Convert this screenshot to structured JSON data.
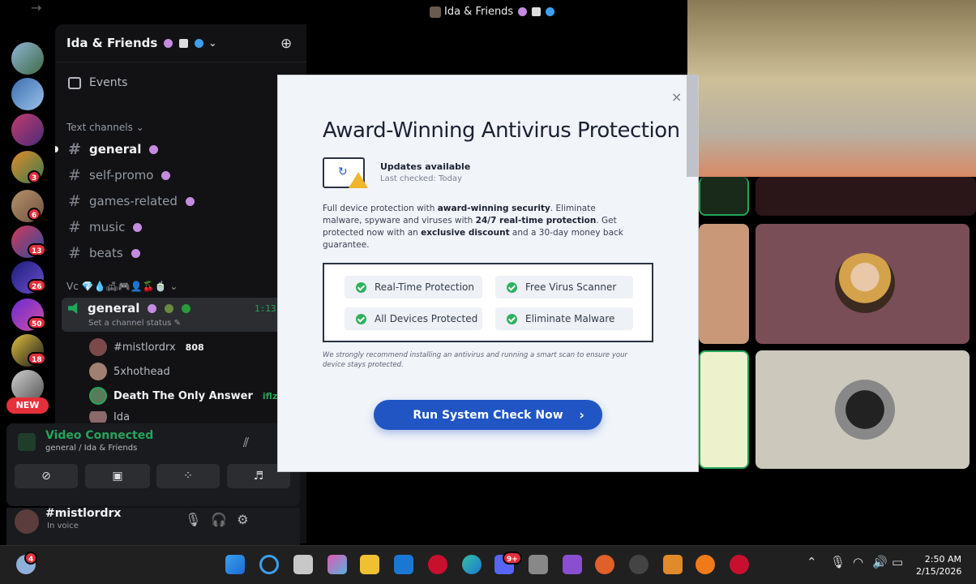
{
  "window": {
    "title": "Ida & Friends",
    "back": "←",
    "forward": "→"
  },
  "server": {
    "name": "Ida & Friends",
    "events_label": "Events",
    "text_category": "Text channels",
    "text_channels": [
      "general",
      "self-promo",
      "games-related",
      "music",
      "beats"
    ],
    "voice_category": "Vc",
    "voice_channel": {
      "name": "general",
      "time": "1:13",
      "status": "Set a channel status"
    },
    "voice_users": [
      {
        "name": "#mistlordrx",
        "tag": "808"
      },
      {
        "name": "5xhothead",
        "tag": ""
      },
      {
        "name": "Death The Only Answer",
        "tag": "iflze"
      },
      {
        "name": "Ida",
        "tag": ""
      }
    ],
    "rail_badges": [
      "3",
      "6",
      "13",
      "26",
      "50",
      "18"
    ],
    "new_label": "NEW"
  },
  "voice_panel": {
    "title": "Video Connected",
    "subtitle": "general / Ida & Friends"
  },
  "user_panel": {
    "name": "#mistlordrx",
    "status": "In voice"
  },
  "modal": {
    "title": "Award-Winning Antivirus Protection",
    "close": "×",
    "update_heading": "Updates available",
    "update_sub": "Last checked: Today",
    "para_1": "Full device protection with ",
    "para_b1": "award-winning security",
    "para_2": ". Eliminate malware, spyware and viruses with ",
    "para_b2": "24/7 real-time protection",
    "para_3": ". Get protected now with an ",
    "para_b3": "exclusive discount",
    "para_4": " and a 30-day money back guarantee.",
    "features": [
      "Real-Time Protection",
      "Free Virus Scanner",
      "All Devices Protected",
      "Eliminate Malware"
    ],
    "note": "We strongly recommend installing an antivirus and running a smart scan to ensure your device stays protected.",
    "button": "Run System Check Now",
    "button_arrow": "›"
  },
  "taskbar": {
    "weather_badge": "4",
    "discord_badge": "9+",
    "time": "2:50 AM",
    "date": "2/15/2026"
  },
  "colors": {
    "accent_green": "#23a55a",
    "button_blue": "#2155c4",
    "badge_red": "#e4303b"
  }
}
